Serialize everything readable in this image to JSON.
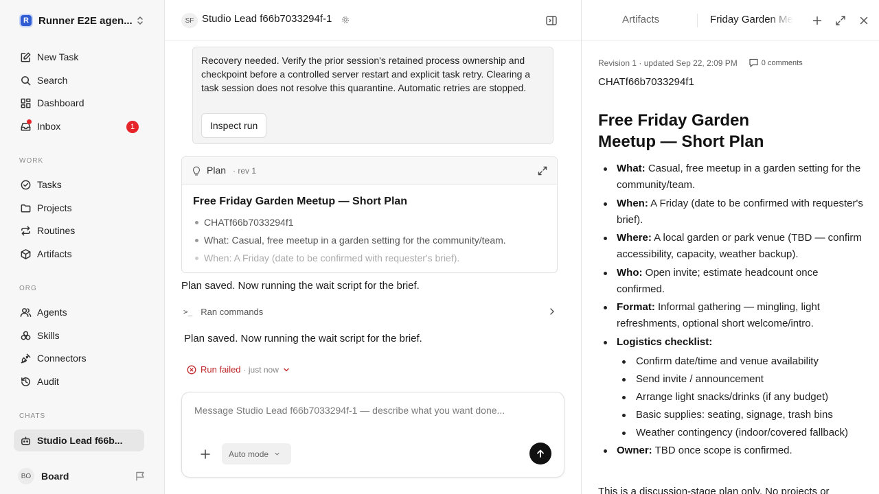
{
  "sidebar": {
    "workspace": {
      "logo": "R",
      "name": "Runner E2E agen..."
    },
    "nav": [
      {
        "label": "New Task"
      },
      {
        "label": "Search"
      },
      {
        "label": "Dashboard"
      },
      {
        "label": "Inbox",
        "badge": "1"
      }
    ],
    "work_section": "WORK",
    "work": [
      {
        "label": "Tasks"
      },
      {
        "label": "Projects"
      },
      {
        "label": "Routines"
      },
      {
        "label": "Artifacts"
      }
    ],
    "org_section": "ORG",
    "org": [
      {
        "label": "Agents"
      },
      {
        "label": "Skills"
      },
      {
        "label": "Connectors"
      },
      {
        "label": "Audit"
      }
    ],
    "chats_section": "CHATS",
    "chats": [
      {
        "label": "Studio Lead f66b..."
      }
    ],
    "user": {
      "initials": "BO",
      "name": "Board"
    }
  },
  "main": {
    "header": {
      "initials": "SF",
      "title": "Studio Lead f66b7033294f-1"
    },
    "recovery": {
      "text": "Recovery needed. Verify the prior session's retained process ownership and checkpoint before a controlled server restart and explicit task retry. Clearing a task session does not resolve this quarantine. Automatic retries are stopped.",
      "button": "Inspect run"
    },
    "plan": {
      "label": "Plan",
      "rev": "· rev 1",
      "title": "Free Friday Garden Meetup — Short Plan",
      "items": [
        "CHATf66b7033294f1",
        "What: Casual, free meetup in a garden setting for the community/team.",
        "When: A Friday (date to be confirmed with requester's brief)."
      ]
    },
    "message1": "Plan saved. Now running the wait script for the brief.",
    "ran_commands": "Ran commands",
    "message2": "Plan saved. Now running the wait script for the brief.",
    "run_status": {
      "label": "Run failed",
      "time": "· just now"
    },
    "composer": {
      "placeholder": "Message Studio Lead f66b7033294f-1 — describe what you want done...",
      "mode": "Auto mode"
    }
  },
  "panel": {
    "tabs": [
      {
        "label": "Artifacts"
      },
      {
        "label": "Friday Garden Meetup"
      }
    ],
    "meta": "Revision 1 · updated Sep 22, 2:09 PM",
    "comments": "0 comments",
    "artifact_id": "CHATf66b7033294f1",
    "title": "Free Friday Garden Meetup — Short Plan",
    "items": [
      {
        "label": "What:",
        "text": " Casual, free meetup in a garden setting for the community/team."
      },
      {
        "label": "When:",
        "text": " A Friday (date to be confirmed with requester's brief)."
      },
      {
        "label": "Where:",
        "text": " A local garden or park venue (TBD — confirm accessibility, capacity, weather backup)."
      },
      {
        "label": "Who:",
        "text": " Open invite; estimate headcount once confirmed."
      },
      {
        "label": "Format:",
        "text": " Informal gathering — mingling, light refreshments, optional short welcome/intro."
      },
      {
        "label": "Logistics checklist:",
        "text": ""
      },
      {
        "label": "Owner:",
        "text": " TBD once scope is confirmed."
      }
    ],
    "checklist": [
      "Confirm date/time and venue availability",
      "Send invite / announcement",
      "Arrange light snacks/drinks (if any budget)",
      "Basic supplies: seating, signage, trash bins",
      "Weather contingency (indoor/covered fallback)"
    ],
    "tail": "This is a discussion-stage plan only. No projects or"
  },
  "colors": {
    "accent": "#2f5bd3",
    "badge": "#e5252a",
    "error": "#c0292c"
  }
}
